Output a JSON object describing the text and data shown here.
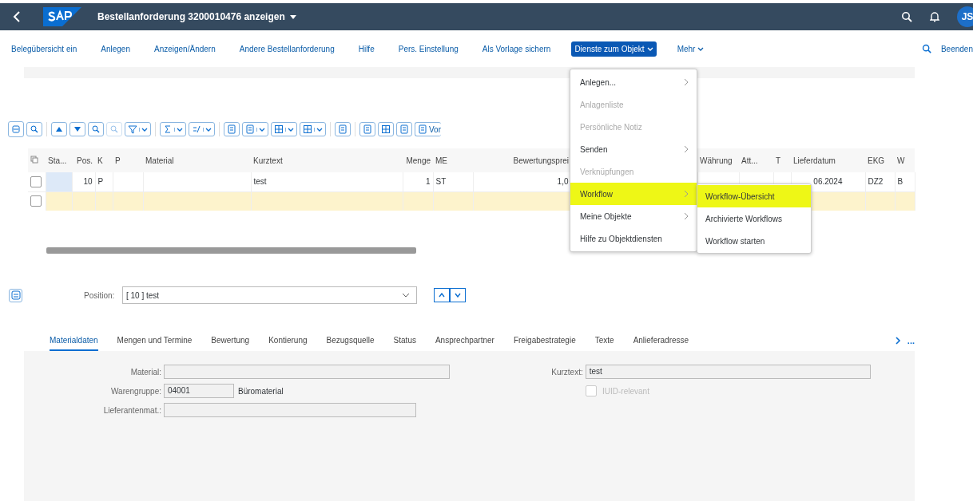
{
  "shell": {
    "title": "Bestellanforderung 3200010476 anzeigen",
    "avatar": "JS"
  },
  "toolbar": {
    "items": [
      {
        "label": "Belegübersicht ein",
        "kind": "link",
        "selected": false
      },
      {
        "label": "Anlegen",
        "kind": "link",
        "selected": false
      },
      {
        "label": "Anzeigen/Ändern",
        "kind": "link",
        "selected": false
      },
      {
        "label": "Andere Bestellanforderung",
        "kind": "link",
        "selected": false
      },
      {
        "label": "Hilfe",
        "kind": "link",
        "selected": false
      },
      {
        "label": "Pers. Einstellung",
        "kind": "link",
        "selected": false
      },
      {
        "label": "Als Vorlage sichern",
        "kind": "link",
        "selected": false
      },
      {
        "label": "Dienste zum Objekt",
        "kind": "menu",
        "selected": true
      },
      {
        "label": "Mehr",
        "kind": "menu",
        "selected": false
      }
    ],
    "exit": "Beenden"
  },
  "menu": {
    "items": [
      {
        "label": "Anlegen...",
        "disabled": false,
        "submenu": true,
        "highlighted": false
      },
      {
        "label": "Anlagenliste",
        "disabled": true,
        "submenu": false,
        "highlighted": false
      },
      {
        "label": "Persönliche Notiz",
        "disabled": true,
        "submenu": false,
        "highlighted": false
      },
      {
        "label": "Senden",
        "disabled": false,
        "submenu": true,
        "highlighted": false
      },
      {
        "label": "Verknüpfungen",
        "disabled": true,
        "submenu": false,
        "highlighted": false
      },
      {
        "label": "Workflow",
        "disabled": false,
        "submenu": true,
        "highlighted": true
      },
      {
        "label": "Meine Objekte",
        "disabled": false,
        "submenu": true,
        "highlighted": false
      },
      {
        "label": "Hilfe zu Objektdiensten",
        "disabled": false,
        "submenu": false,
        "highlighted": false
      }
    ]
  },
  "submenu": {
    "items": [
      {
        "label": "Workflow-Übersicht",
        "highlighted": true
      },
      {
        "label": "Archivierte Workflows",
        "highlighted": false
      },
      {
        "label": "Workflow starten",
        "highlighted": false
      }
    ]
  },
  "table": {
    "tool_button": "Vor",
    "columns": [
      "Sta...",
      "Pos.",
      "K",
      "P",
      "Material",
      "Kurztext",
      "Menge",
      "ME",
      "Bewertungsprei",
      "Währung",
      "Att...",
      "T",
      "Lieferdatum",
      "EKG",
      "W"
    ],
    "rows": [
      {
        "kind": "item",
        "checked": false,
        "cells": [
          null,
          "10",
          "P",
          null,
          null,
          "test",
          "1",
          "ST",
          "1,0",
          null,
          null,
          null,
          "06.2024",
          "DZ2",
          "B"
        ]
      },
      {
        "kind": "entry",
        "checked": false,
        "cells": []
      }
    ]
  },
  "position": {
    "label": "Position:",
    "value": "[ 10 ] test"
  },
  "tabs": [
    {
      "label": "Materialdaten",
      "selected": true
    },
    {
      "label": "Mengen und Termine",
      "selected": false
    },
    {
      "label": "Bewertung",
      "selected": false
    },
    {
      "label": "Kontierung",
      "selected": false
    },
    {
      "label": "Bezugsquelle",
      "selected": false
    },
    {
      "label": "Status",
      "selected": false
    },
    {
      "label": "Ansprechpartner",
      "selected": false
    },
    {
      "label": "Freigabestrategie",
      "selected": false
    },
    {
      "label": "Texte",
      "selected": false
    },
    {
      "label": "Anlieferadresse",
      "selected": false
    }
  ],
  "tabs_more": "...",
  "form": {
    "material": {
      "label": "Material:"
    },
    "warengruppe": {
      "label": "Warengruppe:",
      "value": "04001",
      "description": "Büromaterial"
    },
    "lieferantenmat": {
      "label": "Lieferantenmat.:"
    },
    "kurztext": {
      "label": "Kurztext:",
      "value": "test"
    },
    "iuid": {
      "label": "IUID-relevant",
      "checked": false,
      "disabled": true
    }
  }
}
